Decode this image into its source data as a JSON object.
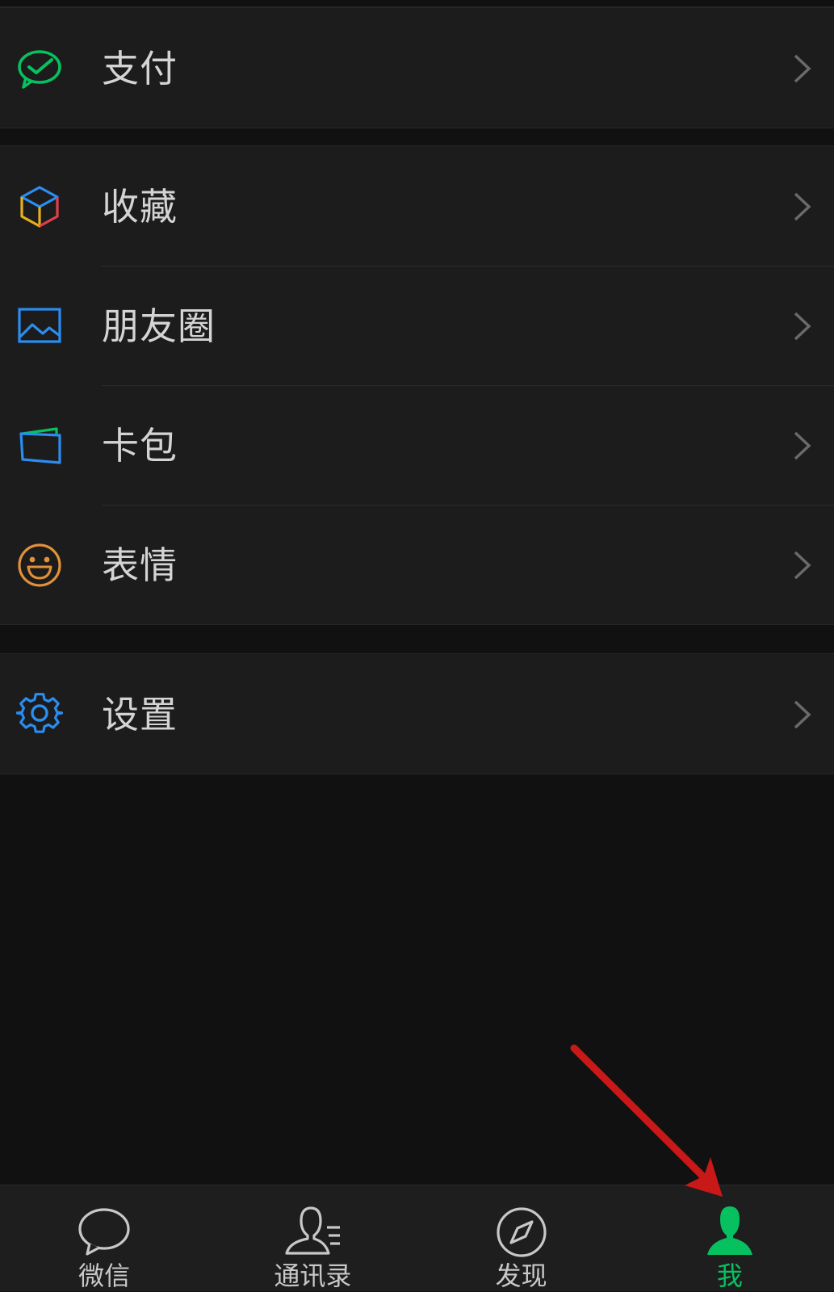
{
  "menu": {
    "pay": {
      "label": "支付"
    },
    "favorites": {
      "label": "收藏"
    },
    "moments": {
      "label": "朋友圈"
    },
    "cards": {
      "label": "卡包"
    },
    "stickers": {
      "label": "表情"
    },
    "settings": {
      "label": "设置"
    }
  },
  "tabbar": {
    "tabs": [
      {
        "label": "微信",
        "icon": "chat-bubble-icon",
        "active": false
      },
      {
        "label": "通讯录",
        "icon": "contacts-icon",
        "active": false
      },
      {
        "label": "发现",
        "icon": "compass-icon",
        "active": false
      },
      {
        "label": "我",
        "icon": "person-icon",
        "active": true
      }
    ]
  },
  "colors": {
    "background": "#111111",
    "row_background": "#1c1c1c",
    "text": "#d4d4d4",
    "accent_green": "#07c160",
    "icon_blue": "#2b8df0",
    "icon_orange": "#e0913a",
    "annotation_red": "#d01e1e"
  }
}
